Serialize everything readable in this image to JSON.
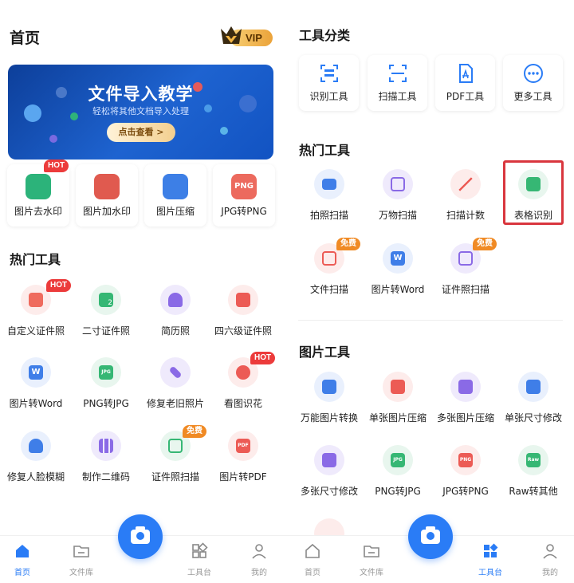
{
  "left": {
    "title": "首页",
    "vip_label": "VIP",
    "banner": {
      "title": "文件导入教学",
      "subtitle": "轻松将其他文档导入处理",
      "button": "点击查看 >"
    },
    "quick_tools": [
      {
        "label": "图片去水印",
        "badge": "HOT"
      },
      {
        "label": "图片加水印"
      },
      {
        "label": "图片压缩"
      },
      {
        "label": "JPG转PNG",
        "icon_text": "PNG"
      }
    ],
    "hot_title": "热门工具",
    "hot_tools": [
      {
        "label": "自定义证件照",
        "badge": "HOT"
      },
      {
        "label": "二寸证件照",
        "icon_text": "2"
      },
      {
        "label": "简历照"
      },
      {
        "label": "四六级证件照"
      },
      {
        "label": "图片转Word",
        "icon_text": "W"
      },
      {
        "label": "PNG转JPG",
        "icon_text": "JPG"
      },
      {
        "label": "修复老旧照片"
      },
      {
        "label": "看图识花",
        "badge": "HOT"
      },
      {
        "label": "修复人脸模糊"
      },
      {
        "label": "制作二维码"
      },
      {
        "label": "证件照扫描",
        "badge": "免费"
      },
      {
        "label": "图片转PDF",
        "icon_text": "PDF"
      }
    ],
    "nav": [
      {
        "label": "首页",
        "icon": "home-icon",
        "active": true
      },
      {
        "label": "文件库",
        "icon": "folder-icon"
      },
      {
        "label": "工具台",
        "icon": "apps-icon"
      },
      {
        "label": "我的",
        "icon": "user-icon"
      }
    ]
  },
  "right": {
    "category_title": "工具分类",
    "categories": [
      {
        "label": "识别工具",
        "icon": "scan-text-icon"
      },
      {
        "label": "扫描工具",
        "icon": "scan-frame-icon"
      },
      {
        "label": "PDF工具",
        "icon": "pdf-icon"
      },
      {
        "label": "更多工具",
        "icon": "more-icon"
      }
    ],
    "hot_title": "热门工具",
    "hot_tools": [
      {
        "label": "拍照扫描"
      },
      {
        "label": "万物扫描"
      },
      {
        "label": "扫描计数"
      },
      {
        "label": "表格识别"
      },
      {
        "label": "文件扫描",
        "badge": "免费"
      },
      {
        "label": "图片转Word",
        "icon_text": "W"
      },
      {
        "label": "证件照扫描",
        "badge": "免费"
      }
    ],
    "image_title": "图片工具",
    "image_tools": [
      {
        "label": "万能图片转换"
      },
      {
        "label": "单张图片压缩"
      },
      {
        "label": "多张图片压缩"
      },
      {
        "label": "单张尺寸修改"
      },
      {
        "label": "多张尺寸修改"
      },
      {
        "label": "PNG转JPG",
        "icon_text": "JPG"
      },
      {
        "label": "JPG转PNG",
        "icon_text": "PNG"
      },
      {
        "label": "Raw转其他",
        "icon_text": "Raw"
      }
    ],
    "nav": [
      {
        "label": "首页",
        "icon": "home-icon"
      },
      {
        "label": "文件库",
        "icon": "folder-icon"
      },
      {
        "label": "工具台",
        "icon": "apps-icon",
        "active": true
      },
      {
        "label": "我的",
        "icon": "user-icon"
      }
    ]
  },
  "colors": {
    "accent": "#2a7cf6",
    "hot_badge": "#ec3b3b",
    "free_badge": "#f08a24",
    "highlight_border": "#d9363e"
  }
}
